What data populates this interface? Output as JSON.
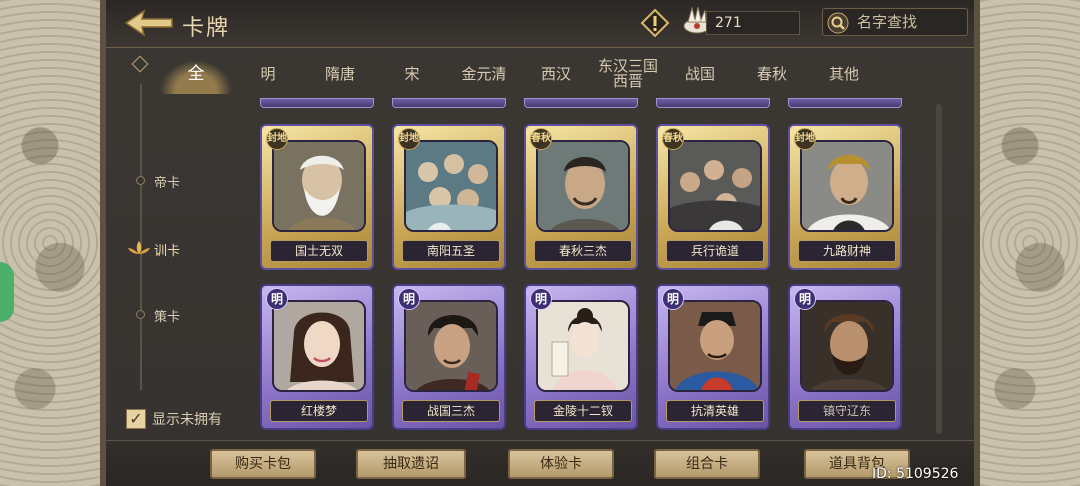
{
  "header": {
    "title": "卡牌",
    "currency_value": "271",
    "search_placeholder": "名字查找"
  },
  "tabs": [
    {
      "label": "全",
      "active": true
    },
    {
      "label": "明"
    },
    {
      "label": "隋唐"
    },
    {
      "label": "宋"
    },
    {
      "label": "金元清"
    },
    {
      "label": "西汉"
    },
    {
      "label": "东汉三国西晋"
    },
    {
      "label": "战国"
    },
    {
      "label": "春秋"
    },
    {
      "label": "其他"
    }
  ],
  "categories": [
    {
      "label": "帝卡"
    },
    {
      "label": "训卡",
      "active": true
    },
    {
      "label": "策卡"
    }
  ],
  "show_unowned": {
    "label": "显示未拥有",
    "checked": true,
    "check_mark": "✓"
  },
  "cards_row1": [
    {
      "badge": "封地",
      "name": "国士无双",
      "icon": "elder-sage-portrait"
    },
    {
      "badge": "封地",
      "name": "南阳五圣",
      "icon": "group-portrait"
    },
    {
      "badge": "春秋",
      "name": "春秋三杰",
      "icon": "scholar-portrait"
    },
    {
      "badge": "春秋",
      "name": "兵行诡道",
      "icon": "generals-portrait"
    },
    {
      "badge": "封地",
      "name": "九路财神",
      "icon": "armored-general-portrait"
    }
  ],
  "cards_row2": [
    {
      "badge": "明",
      "name": "红楼梦",
      "icon": "lady-portrait"
    },
    {
      "badge": "明",
      "name": "战国三杰",
      "icon": "swordsman-portrait"
    },
    {
      "badge": "明",
      "name": "金陵十二钗",
      "icon": "maiden-portrait"
    },
    {
      "badge": "明",
      "name": "抗清英雄",
      "icon": "official-portrait"
    },
    {
      "badge": "明",
      "name": "镇守辽东",
      "icon": "bearded-warrior-portrait"
    }
  ],
  "bottom_buttons": [
    "购买卡包",
    "抽取遗诏",
    "体验卡",
    "组合卡",
    "道具背包"
  ],
  "id_label": "ID: 5109526",
  "colors": {
    "gold_card": "#c9a655",
    "purple_card": "#8b74c8",
    "accent": "#e8d6b0"
  }
}
